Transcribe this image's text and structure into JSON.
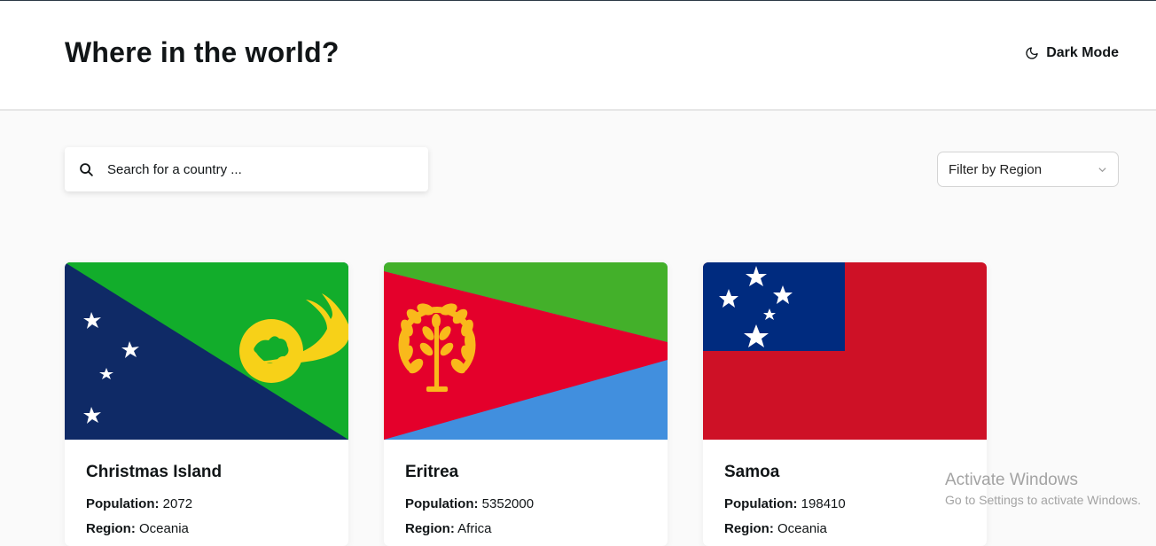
{
  "header": {
    "title": "Where in the world?",
    "dark_mode_label": "Dark Mode",
    "dark_mode_icon": "moon-icon"
  },
  "search": {
    "placeholder": "Search for a country ...",
    "value": "",
    "icon": "search-icon"
  },
  "filter": {
    "selected": "Filter by Region",
    "icon": "chevron-down-icon"
  },
  "labels": {
    "population": "Population:",
    "region": "Region:"
  },
  "countries": [
    {
      "name": "Christmas Island",
      "population": "2072",
      "region": "Oceania",
      "flag": "christmas-island-flag"
    },
    {
      "name": "Eritrea",
      "population": "5352000",
      "region": "Africa",
      "flag": "eritrea-flag"
    },
    {
      "name": "Samoa",
      "population": "198410",
      "region": "Oceania",
      "flag": "samoa-flag"
    }
  ],
  "watermark": {
    "line1": "Activate Windows",
    "line2": "Go to Settings to activate Windows."
  },
  "colors": {
    "background": "#fafafa",
    "surface": "#ffffff",
    "text": "#111517"
  }
}
